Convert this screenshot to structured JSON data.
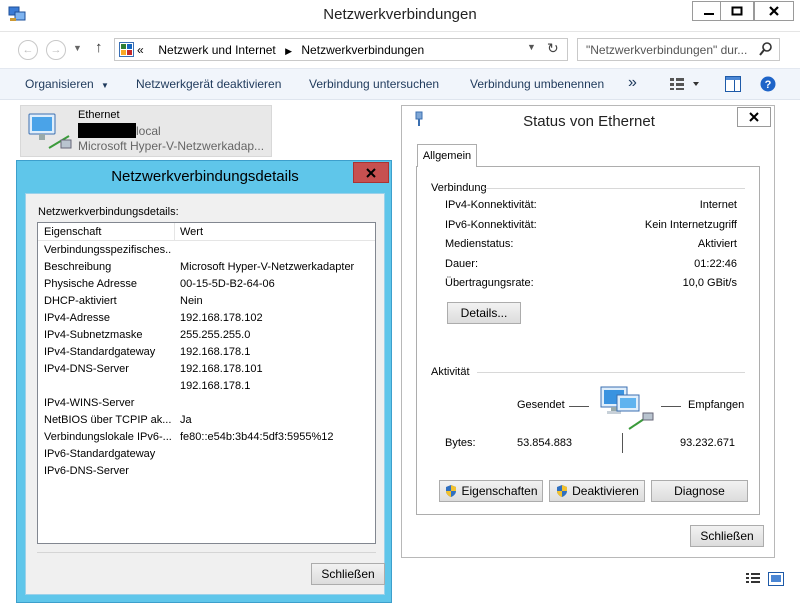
{
  "window": {
    "title": "Netzwerkverbindungen"
  },
  "address": {
    "prefix": "«",
    "crumb1": "Netzwerk und Internet",
    "crumb2": "Netzwerkverbindungen",
    "search_placeholder": "\"Netzwerkverbindungen\" dur..."
  },
  "toolbar": {
    "organize": "Organisieren",
    "disable": "Netzwerkgerät deaktivieren",
    "diagnose": "Verbindung untersuchen",
    "rename": "Verbindung umbenennen",
    "more": "»"
  },
  "adapter_item": {
    "name": "Ethernet",
    "network": "local",
    "device": "Microsoft Hyper-V-Netzwerkadap..."
  },
  "details_dialog": {
    "title": "Netzwerkverbindungsdetails",
    "label": "Netzwerkverbindungsdetails:",
    "col_property": "Eigenschaft",
    "col_value": "Wert",
    "rows": [
      {
        "k": "Verbindungsspezifisches...",
        "v": ""
      },
      {
        "k": "Beschreibung",
        "v": "Microsoft Hyper-V-Netzwerkadapter"
      },
      {
        "k": "Physische Adresse",
        "v": "00-15-5D-B2-64-06"
      },
      {
        "k": "DHCP-aktiviert",
        "v": "Nein"
      },
      {
        "k": "IPv4-Adresse",
        "v": "192.168.178.102"
      },
      {
        "k": "IPv4-Subnetzmaske",
        "v": "255.255.255.0"
      },
      {
        "k": "IPv4-Standardgateway",
        "v": "192.168.178.1"
      },
      {
        "k": "IPv4-DNS-Server",
        "v": "192.168.178.101"
      },
      {
        "k": "",
        "v": "192.168.178.1"
      },
      {
        "k": "IPv4-WINS-Server",
        "v": ""
      },
      {
        "k": "NetBIOS über TCPIP ak...",
        "v": "Ja"
      },
      {
        "k": "Verbindungslokale IPv6-...",
        "v": "fe80::e54b:3b44:5df3:5955%12"
      },
      {
        "k": "IPv6-Standardgateway",
        "v": ""
      },
      {
        "k": "IPv6-DNS-Server",
        "v": ""
      }
    ],
    "close_label": "Schließen"
  },
  "status_dialog": {
    "title": "Status von Ethernet",
    "tab": "Allgemein",
    "connection_title": "Verbindung",
    "rows": [
      {
        "k": "IPv4-Konnektivität:",
        "v": "Internet"
      },
      {
        "k": "IPv6-Konnektivität:",
        "v": "Kein Internetzugriff"
      },
      {
        "k": "Medienstatus:",
        "v": "Aktiviert"
      },
      {
        "k": "Dauer:",
        "v": "01:22:46"
      },
      {
        "k": "Übertragungsrate:",
        "v": "10,0 GBit/s"
      }
    ],
    "details_button": "Details...",
    "activity_title": "Aktivität",
    "sent_label": "Gesendet",
    "received_label": "Empfangen",
    "bytes_label": "Bytes:",
    "bytes_sent": "53.854.883",
    "bytes_received": "93.232.671",
    "properties_button": "Eigenschaften",
    "deactivate_button": "Deaktivieren",
    "diagnose_button": "Diagnose",
    "close_label": "Schließen"
  },
  "colors": {
    "details_frame": "#5fc6ea",
    "close_red": "#c75050",
    "command_text": "#1e395b"
  }
}
